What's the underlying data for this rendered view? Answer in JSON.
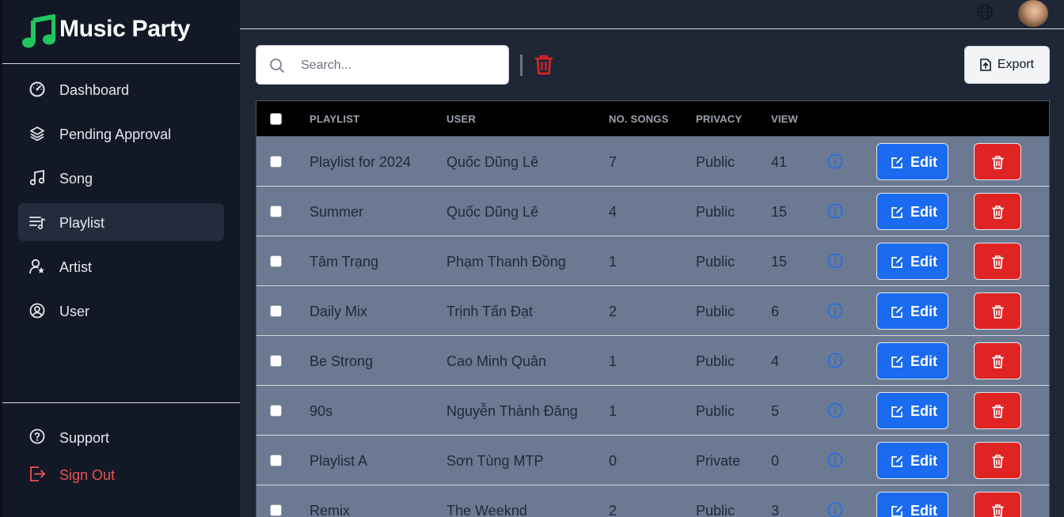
{
  "brand": {
    "title": "Music Party"
  },
  "sidebar": {
    "items": [
      {
        "label": "Dashboard",
        "icon": "dashboard-icon"
      },
      {
        "label": "Pending Approval",
        "icon": "layers-icon"
      },
      {
        "label": "Song",
        "icon": "music-note-icon"
      },
      {
        "label": "Playlist",
        "icon": "playlist-icon",
        "active": true
      },
      {
        "label": "Artist",
        "icon": "artist-icon"
      },
      {
        "label": "User",
        "icon": "user-circle-icon"
      }
    ],
    "bottom": [
      {
        "label": "Support",
        "icon": "help-icon"
      },
      {
        "label": "Sign Out",
        "icon": "sign-out-icon"
      }
    ]
  },
  "toolbar": {
    "search_placeholder": "Search...",
    "export_label": "Export"
  },
  "table": {
    "columns": [
      "Playlist",
      "User",
      "No. Songs",
      "Privacy",
      "View"
    ],
    "rows": [
      {
        "playlist": "Playlist for 2024",
        "user": "Quốc Dũng Lê",
        "songs": "7",
        "privacy": "Public",
        "view": "41"
      },
      {
        "playlist": "Summer",
        "user": "Quốc Dũng Lê",
        "songs": "4",
        "privacy": "Public",
        "view": "15"
      },
      {
        "playlist": "Tâm Trạng",
        "user": "Phạm Thanh Đồng",
        "songs": "1",
        "privacy": "Public",
        "view": "15"
      },
      {
        "playlist": "Daily Mix",
        "user": "Trịnh Tấn Đạt",
        "songs": "2",
        "privacy": "Public",
        "view": "6"
      },
      {
        "playlist": "Be Strong",
        "user": "Cao Minh Quân",
        "songs": "1",
        "privacy": "Public",
        "view": "4"
      },
      {
        "playlist": "90s",
        "user": "Nguyễn Thành Đăng",
        "songs": "1",
        "privacy": "Public",
        "view": "5"
      },
      {
        "playlist": "Playlist A",
        "user": "Sơn Tùng MTP",
        "songs": "0",
        "privacy": "Private",
        "view": "0"
      },
      {
        "playlist": "Remix",
        "user": "The Weeknd",
        "songs": "2",
        "privacy": "Public",
        "view": "3"
      }
    ],
    "edit_label": "Edit"
  },
  "colors": {
    "brand_green": "#22c55e",
    "edit_blue": "#1a6bf0",
    "delete_red": "#e02424",
    "signout_red": "#f05252"
  }
}
